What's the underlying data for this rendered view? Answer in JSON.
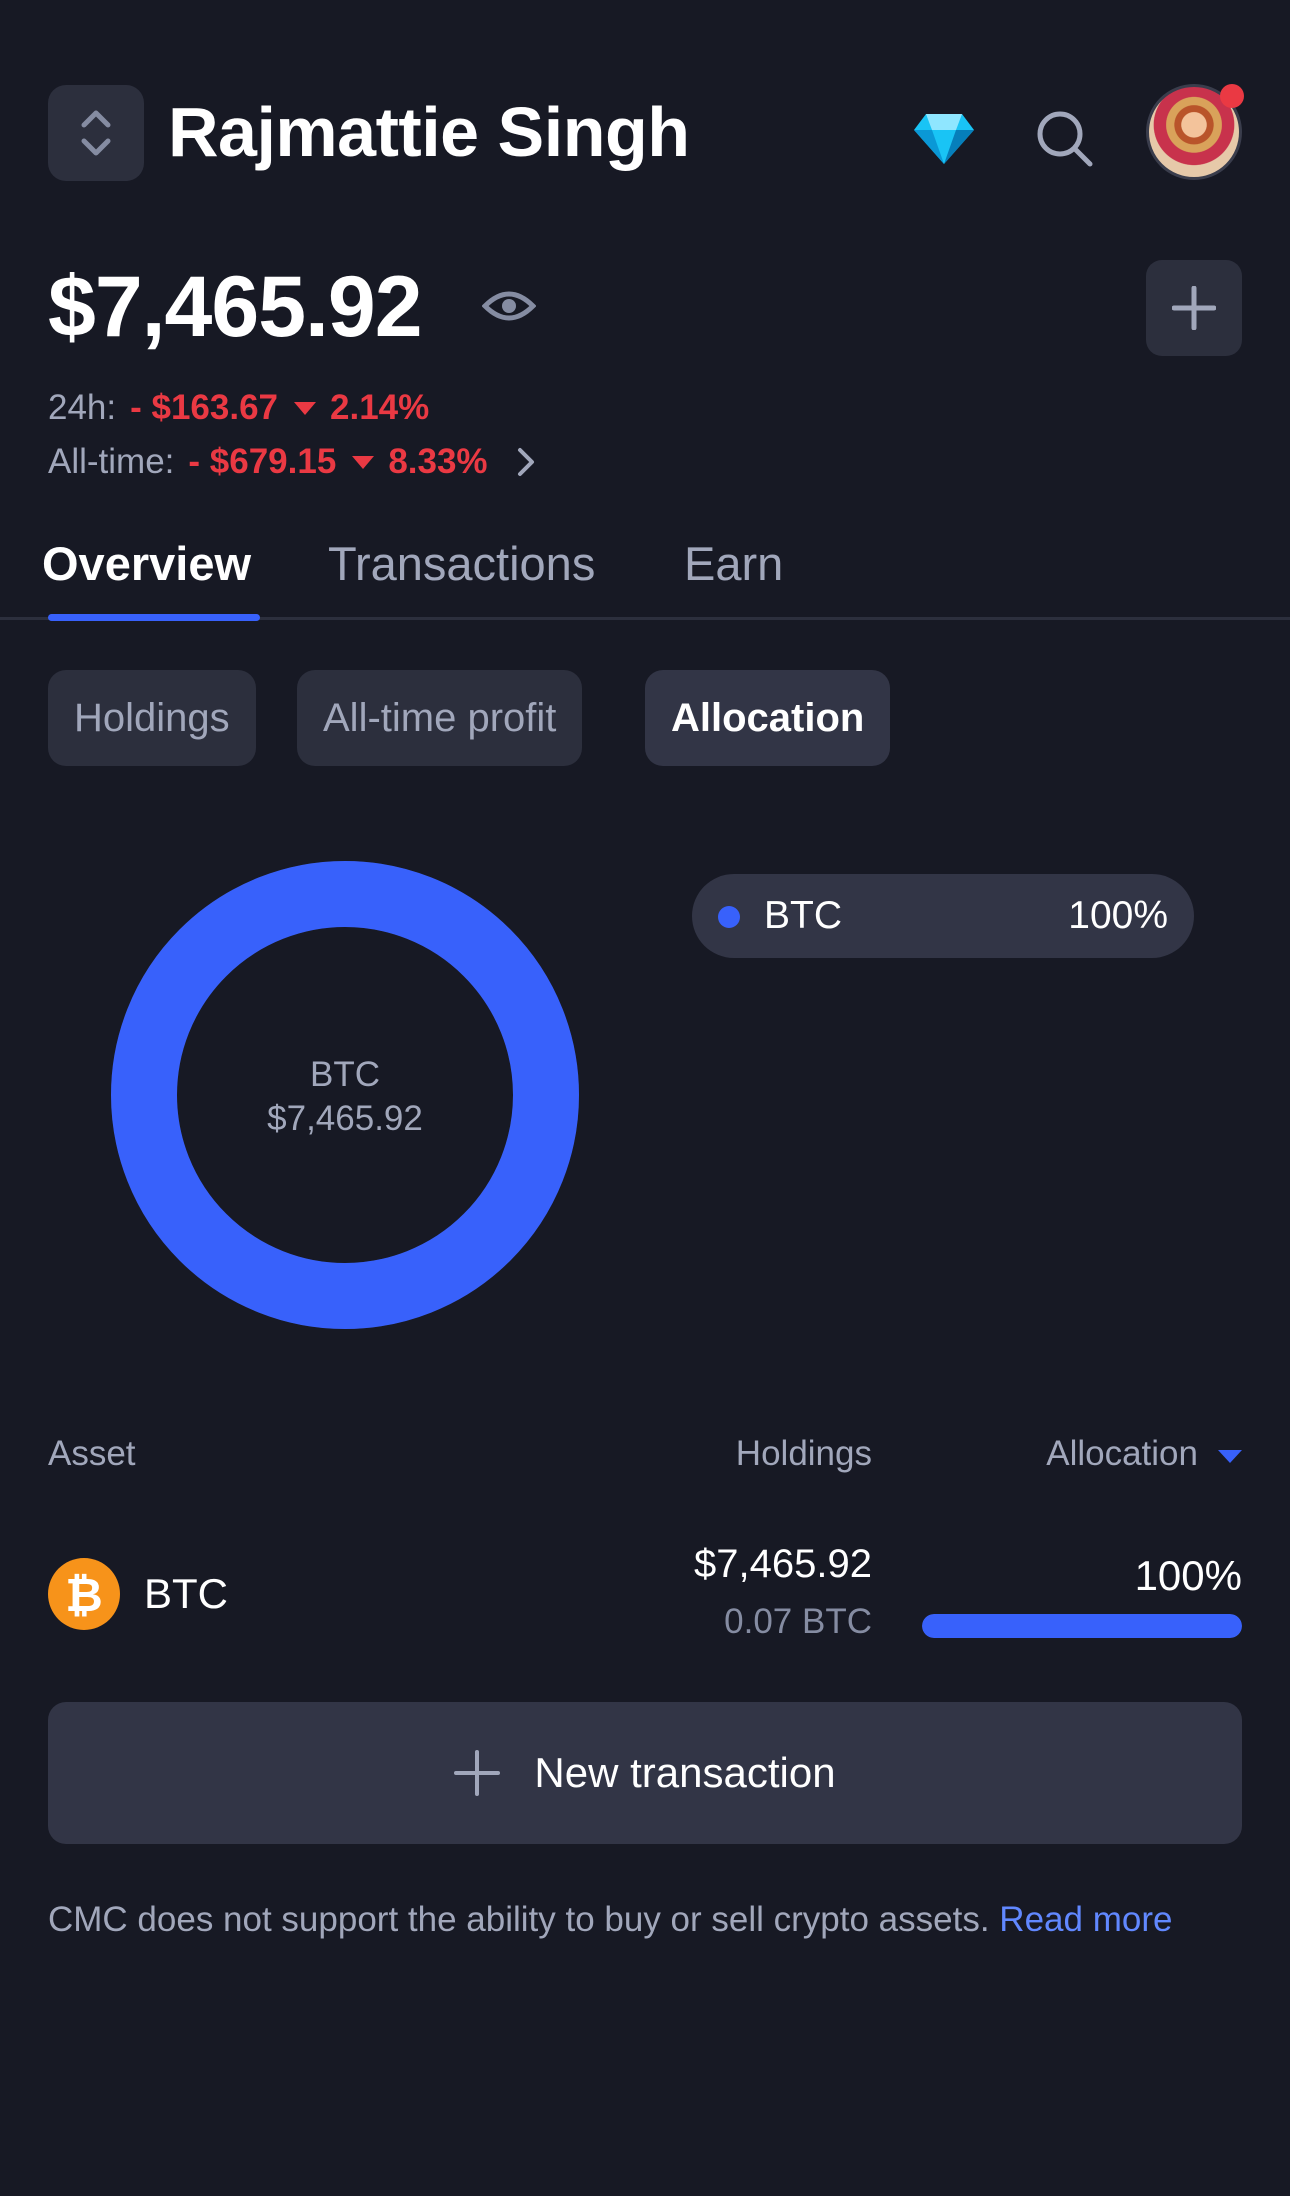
{
  "header": {
    "portfolio_name": "Rajmattie Singh"
  },
  "balance": {
    "total": "$7,465.92",
    "change_24h_label": "24h:",
    "change_24h_value": "- $163.67",
    "change_24h_pct": "2.14%",
    "alltime_label": "All-time:",
    "alltime_value": "- $679.15",
    "alltime_pct": "8.33%"
  },
  "tabs": [
    {
      "label": "Overview",
      "active": true
    },
    {
      "label": "Transactions",
      "active": false
    },
    {
      "label": "Earn",
      "active": false
    }
  ],
  "chips": [
    {
      "label": "Holdings",
      "active": false
    },
    {
      "label": "All-time profit",
      "active": false
    },
    {
      "label": "Allocation",
      "active": true
    }
  ],
  "allocation_chart": {
    "center_label": "BTC",
    "center_value": "$7,465.92",
    "legend": [
      {
        "name": "BTC",
        "pct": "100%"
      }
    ],
    "share_pct": 100,
    "color": "#3861fb"
  },
  "table": {
    "headers": {
      "asset": "Asset",
      "holdings": "Holdings",
      "allocation": "Allocation"
    },
    "rows": [
      {
        "symbol": "BTC",
        "icon": "bitcoin-icon",
        "holdings_usd": "$7,465.92",
        "holdings_qty": "0.07 BTC",
        "allocation": "100%",
        "allocation_fraction": 1.0
      }
    ]
  },
  "actions": {
    "new_transaction": "New transaction"
  },
  "footer": {
    "disclaimer": "CMC does not support the ability to buy or sell crypto assets.",
    "read_more": "Read more"
  },
  "colors": {
    "background": "#171924",
    "accent": "#3861fb",
    "negative": "#ea3943",
    "bitcoin": "#f7931a"
  }
}
